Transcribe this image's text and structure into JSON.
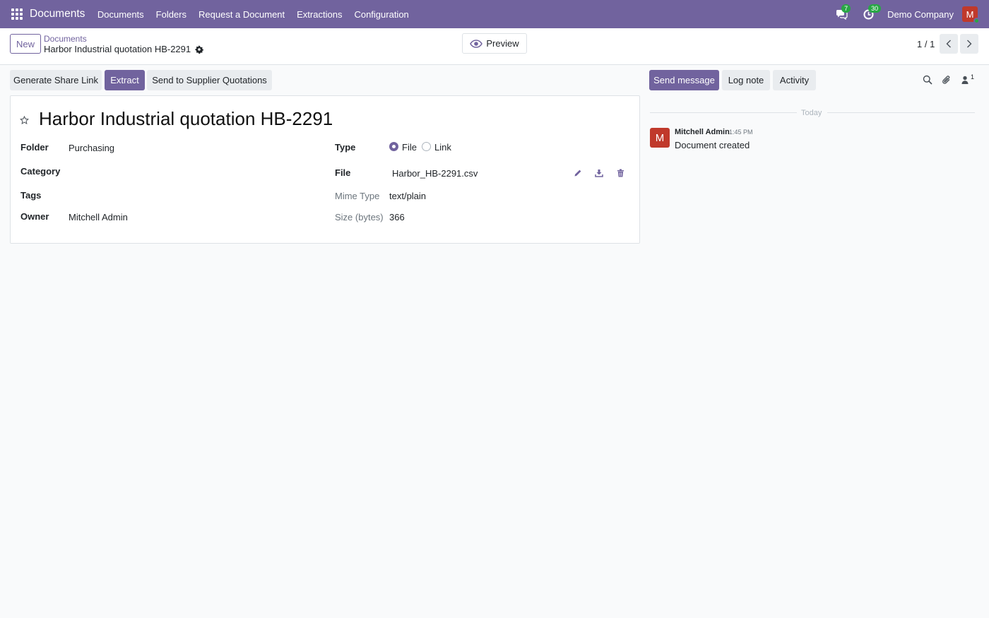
{
  "navbar": {
    "app_name": "Documents",
    "menu": [
      "Documents",
      "Folders",
      "Request a Document",
      "Extractions",
      "Configuration"
    ],
    "messages_count": "7",
    "activities_count": "30",
    "company": "Demo Company",
    "user_initial": "M",
    "accent_color": "#71639e",
    "badge_color": "#28a745"
  },
  "control_panel": {
    "new_label": "New",
    "breadcrumb_parent": "Documents",
    "breadcrumb_current": "Harbor Industrial quotation HB-2291",
    "preview_label": "Preview",
    "pager": "1 / 1"
  },
  "statusbar": {
    "share_label": "Generate Share Link",
    "extract_label": "Extract",
    "send_label": "Send to Supplier Quotations"
  },
  "form": {
    "title": "Harbor Industrial quotation HB-2291",
    "folder_label": "Folder",
    "folder_value": "Purchasing",
    "category_label": "Category",
    "tags_label": "Tags",
    "owner_label": "Owner",
    "owner_value": "Mitchell Admin",
    "type_label": "Type",
    "type_option_file": "File",
    "type_option_link": "Link",
    "type_selected": "File",
    "file_label": "File",
    "file_value": "Harbor_HB-2291.csv",
    "mime_label": "Mime Type",
    "mime_value": "text/plain",
    "size_label": "Size (bytes)",
    "size_value": "366"
  },
  "chatter": {
    "send_message_label": "Send message",
    "log_note_label": "Log note",
    "activity_label": "Activity",
    "followers_count": "1",
    "date_separator": "Today",
    "messages": [
      {
        "author": "Mitchell Admin",
        "author_initial": "M",
        "time": "1:45 PM",
        "body": "Document created"
      }
    ]
  },
  "icons": [
    "apps-icon",
    "chat-icon",
    "clock-icon",
    "gear-icon",
    "eye-icon",
    "chevron-left-icon",
    "chevron-right-icon",
    "star-icon",
    "pencil-icon",
    "download-icon",
    "trash-icon",
    "search-icon",
    "paperclip-icon",
    "user-icon"
  ]
}
